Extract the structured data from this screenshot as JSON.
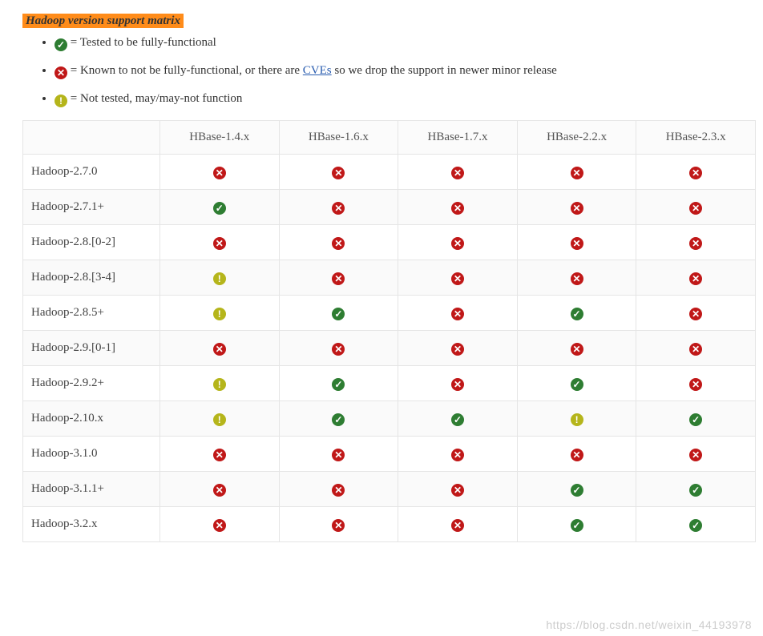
{
  "title": "Hadoop version support matrix",
  "legend": {
    "ok": "= Tested to be fully-functional",
    "bad_prefix": "= Known to not be fully-functional, or there are ",
    "bad_link": "CVEs",
    "bad_suffix": " so we drop the support in newer minor release",
    "warn": "= Not tested, may/may-not function"
  },
  "columns": [
    "HBase-1.4.x",
    "HBase-1.6.x",
    "HBase-1.7.x",
    "HBase-2.2.x",
    "HBase-2.3.x"
  ],
  "rows": [
    {
      "name": "Hadoop-2.7.0",
      "cells": [
        "bad",
        "bad",
        "bad",
        "bad",
        "bad"
      ]
    },
    {
      "name": "Hadoop-2.7.1+",
      "cells": [
        "ok",
        "bad",
        "bad",
        "bad",
        "bad"
      ]
    },
    {
      "name": "Hadoop-2.8.[0-2]",
      "cells": [
        "bad",
        "bad",
        "bad",
        "bad",
        "bad"
      ]
    },
    {
      "name": "Hadoop-2.8.[3-4]",
      "cells": [
        "warn",
        "bad",
        "bad",
        "bad",
        "bad"
      ]
    },
    {
      "name": "Hadoop-2.8.5+",
      "cells": [
        "warn",
        "ok",
        "bad",
        "ok",
        "bad"
      ]
    },
    {
      "name": "Hadoop-2.9.[0-1]",
      "cells": [
        "bad",
        "bad",
        "bad",
        "bad",
        "bad"
      ]
    },
    {
      "name": "Hadoop-2.9.2+",
      "cells": [
        "warn",
        "ok",
        "bad",
        "ok",
        "bad"
      ]
    },
    {
      "name": "Hadoop-2.10.x",
      "cells": [
        "warn",
        "ok",
        "ok",
        "warn",
        "ok"
      ]
    },
    {
      "name": "Hadoop-3.1.0",
      "cells": [
        "bad",
        "bad",
        "bad",
        "bad",
        "bad"
      ]
    },
    {
      "name": "Hadoop-3.1.1+",
      "cells": [
        "bad",
        "bad",
        "bad",
        "ok",
        "ok"
      ]
    },
    {
      "name": "Hadoop-3.2.x",
      "cells": [
        "bad",
        "bad",
        "bad",
        "ok",
        "ok"
      ]
    }
  ],
  "icon_glyph": {
    "ok": "✓",
    "bad": "✕",
    "warn": "!"
  },
  "icon_name": {
    "ok": "check-circle-icon",
    "bad": "x-circle-icon",
    "warn": "exclamation-circle-icon"
  },
  "watermark": "https://blog.csdn.net/weixin_44193978"
}
